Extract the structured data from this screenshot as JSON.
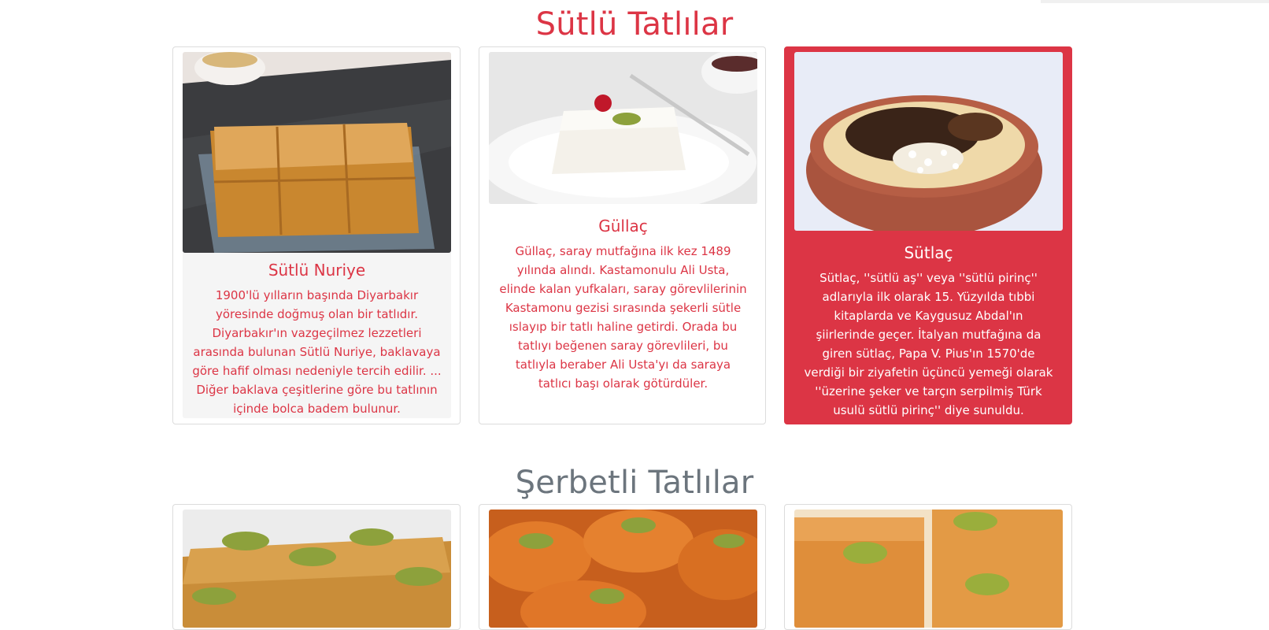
{
  "sections": [
    {
      "title": "Sütlü Tatlılar",
      "cards": [
        {
          "title": "Sütlü Nuriye",
          "text": "1900'lü yılların başında Diyarbakır yöresinde doğmuş olan bir tatlıdır. Diyarbakır'ın vazgeçilmez lezzetleri arasında bulunan Sütlü Nuriye, baklavaya göre hafif olması nedeniyle tercih edilir. ... Diğer baklava çeşitlerine göre bu tatlının içinde bolca badem bulunur."
        },
        {
          "title": "Güllaç",
          "text": "Güllaç, saray mutfağına ilk kez 1489 yılında alındı. Kastamonulu Ali Usta, elinde kalan yufkaları, saray görevlilerinin Kastamonu gezisi sırasında şekerli sütle ıslayıp bir tatlı haline getirdi. Orada bu tatlıyı beğenen saray görevlileri, bu tatlıyla beraber Ali Usta'yı da saraya tatlıcı başı olarak götürdüler."
        },
        {
          "title": "Sütlaç",
          "text": "Sütlaç, ''sütlü aş'' veya ''sütlü pirinç'' adlarıyla ilk olarak 15. Yüzyılda tıbbi kitaplarda ve Kaygusuz Abdal'ın şiirlerinde geçer. İtalyan mutfağına da giren sütlaç, Papa V. Pius'ın 1570'de verdiği bir ziyafetin üçüncü yemeği olarak ''üzerine şeker ve tarçın serpilmiş Türk usulü sütlü pirinç'' diye sunuldu."
        }
      ]
    },
    {
      "title": "Şerbetli Tatlılar"
    }
  ],
  "colors": {
    "accent": "#dc3545",
    "secondary_title": "#6c757d",
    "card_grey_body": "#f5f5f5",
    "card_border": "#dcdcdc"
  }
}
